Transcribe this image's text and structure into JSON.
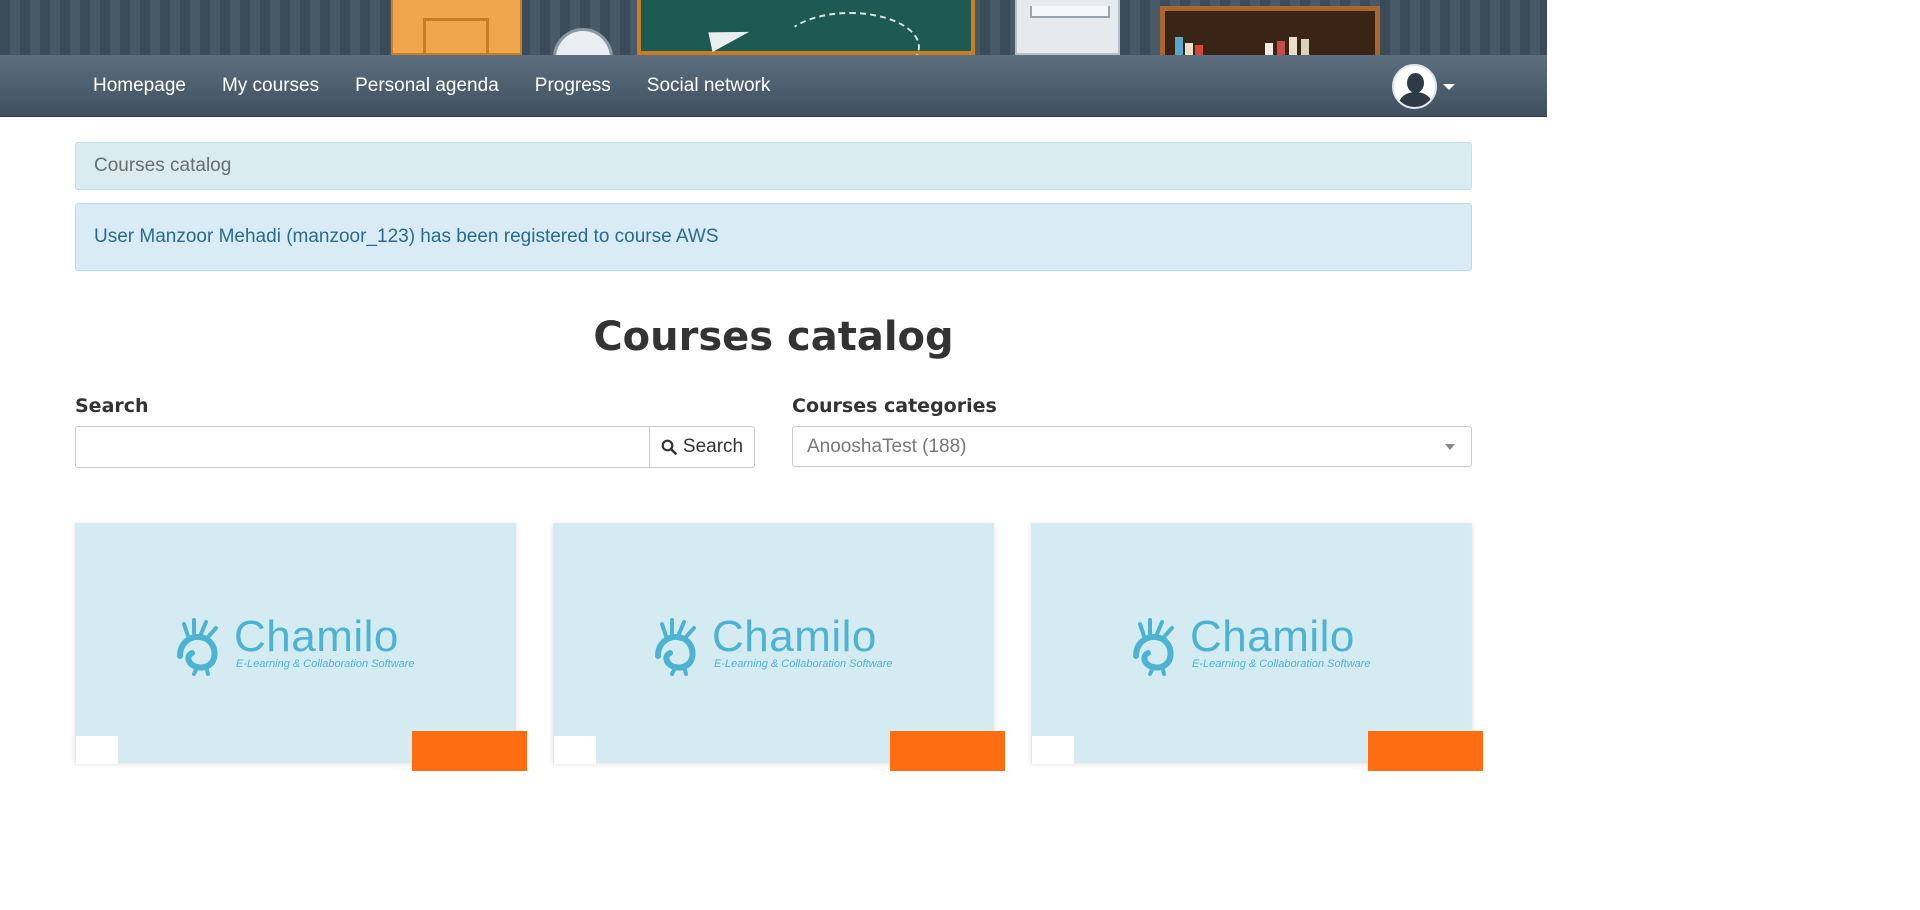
{
  "navbar": {
    "items": [
      {
        "label": "Homepage"
      },
      {
        "label": "My courses"
      },
      {
        "label": "Personal agenda"
      },
      {
        "label": "Progress"
      },
      {
        "label": "Social network"
      }
    ]
  },
  "breadcrumb": {
    "current": "Courses catalog"
  },
  "alert": {
    "message": "User Manzoor Mehadi (manzoor_123) has been registered to course AWS"
  },
  "page": {
    "title": "Courses catalog"
  },
  "search": {
    "label": "Search",
    "value": "",
    "button_label": "Search",
    "icon": "search-icon"
  },
  "categories": {
    "label": "Courses categories",
    "selected": "AnooshaTest (188)"
  },
  "cards": [
    {
      "logo_text": "Chamilo",
      "logo_tagline": "E-Learning & Collaboration Software"
    },
    {
      "logo_text": "Chamilo",
      "logo_tagline": "E-Learning & Collaboration Software"
    },
    {
      "logo_text": "Chamilo",
      "logo_tagline": "E-Learning & Collaboration Software"
    }
  ],
  "colors": {
    "navbar": "#4b5d6c",
    "breadcrumb_bg": "#d9ecef",
    "alert_bg": "#d9ecf5",
    "alert_text": "#2a6a8f",
    "card_bg": "#d4ebf1",
    "logo": "#4db3d2",
    "ribbon": "#ff6d12"
  }
}
